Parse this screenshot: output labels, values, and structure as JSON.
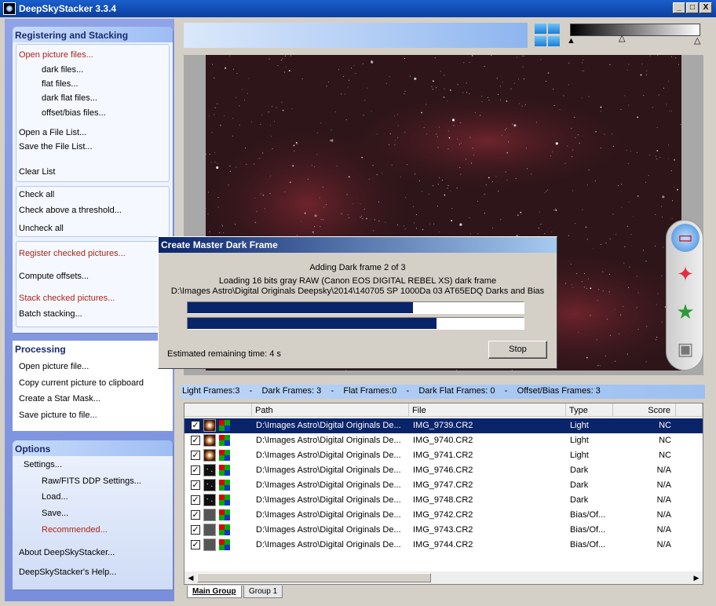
{
  "window": {
    "title": "DeepSkyStacker 3.3.4",
    "min": "_",
    "max": "□",
    "close": "X"
  },
  "reg_panel": {
    "title": "Registering and Stacking",
    "open_pictures": "Open picture files...",
    "dark_files": "dark files...",
    "flat_files": "flat files...",
    "dark_flat_files": "dark flat files...",
    "offset_files": "offset/bias files...",
    "open_list": "Open a File List...",
    "save_list": "Save the File List...",
    "clear_list": "Clear List",
    "check_all": "Check all",
    "check_threshold": "Check above a threshold...",
    "uncheck_all": "Uncheck all",
    "register_checked": "Register checked pictures...",
    "compute_offsets": "Compute offsets...",
    "stack_checked": "Stack checked pictures...",
    "batch_stacking": "Batch stacking..."
  },
  "processing": {
    "title": "Processing",
    "open_picture": "Open picture file...",
    "copy_clipboard": "Copy current picture to clipboard",
    "star_mask": "Create a Star Mask...",
    "save_picture": "Save picture to file..."
  },
  "options": {
    "title": "Options",
    "settings": "Settings...",
    "raw_fits": "Raw/FITS DDP Settings...",
    "load": "Load...",
    "save": "Save...",
    "recommended": "Recommended...",
    "about": "About DeepSkyStacker...",
    "help": "DeepSkyStacker's Help..."
  },
  "dialog": {
    "title": "Create Master Dark Frame",
    "line1": "Adding Dark frame 2 of 3",
    "line2": "Loading 16 bits gray RAW (Canon EOS DIGITAL REBEL XS) dark frame",
    "line3": "D:\\Images Astro\\Digital Originals Deepsky\\2014\\140705 SP 1000Da 03 AT65EDQ Darks and Bias",
    "progress1": 0.67,
    "progress2": 0.74,
    "remaining": "Estimated remaining time: 4 s",
    "stop": "Stop"
  },
  "info_bar": "Light Frames:3    -    Dark Frames: 3    -    Flat Frames:0    -    Dark Flat Frames: 0    -    Offset/Bias Frames: 3",
  "table": {
    "headers": [
      "Path",
      "File",
      "Type",
      "Score"
    ],
    "rows": [
      {
        "path": "D:\\Images Astro\\Digital Originals De...",
        "file": "IMG_9739.CR2",
        "type": "Light",
        "score": "NC",
        "checked": "✓"
      },
      {
        "path": "D:\\Images Astro\\Digital Originals De...",
        "file": "IMG_9740.CR2",
        "type": "Light",
        "score": "NC",
        "checked": "✓"
      },
      {
        "path": "D:\\Images Astro\\Digital Originals De...",
        "file": "IMG_9741.CR2",
        "type": "Light",
        "score": "NC",
        "checked": "✓"
      },
      {
        "path": "D:\\Images Astro\\Digital Originals De...",
        "file": "IMG_9746.CR2",
        "type": "Dark",
        "score": "N/A",
        "checked": "✓"
      },
      {
        "path": "D:\\Images Astro\\Digital Originals De...",
        "file": "IMG_9747.CR2",
        "type": "Dark",
        "score": "N/A",
        "checked": "✓"
      },
      {
        "path": "D:\\Images Astro\\Digital Originals De...",
        "file": "IMG_9748.CR2",
        "type": "Dark",
        "score": "N/A",
        "checked": "✓"
      },
      {
        "path": "D:\\Images Astro\\Digital Originals De...",
        "file": "IMG_9742.CR2",
        "type": "Bias/Of...",
        "score": "N/A",
        "checked": "✓"
      },
      {
        "path": "D:\\Images Astro\\Digital Originals De...",
        "file": "IMG_9743.CR2",
        "type": "Bias/Of...",
        "score": "N/A",
        "checked": "✓"
      },
      {
        "path": "D:\\Images Astro\\Digital Originals De...",
        "file": "IMG_9744.CR2",
        "type": "Bias/Of...",
        "score": "N/A",
        "checked": "✓"
      }
    ]
  },
  "tabs": [
    "Main Group",
    "Group 1"
  ],
  "icons": {
    "tool1": "select-rect-icon",
    "tool2": "star-edit-icon",
    "tool3": "comet-icon",
    "tool4": "save-icon"
  },
  "colors": {
    "accent": "#0a246a",
    "red_action": "#a8261b"
  }
}
